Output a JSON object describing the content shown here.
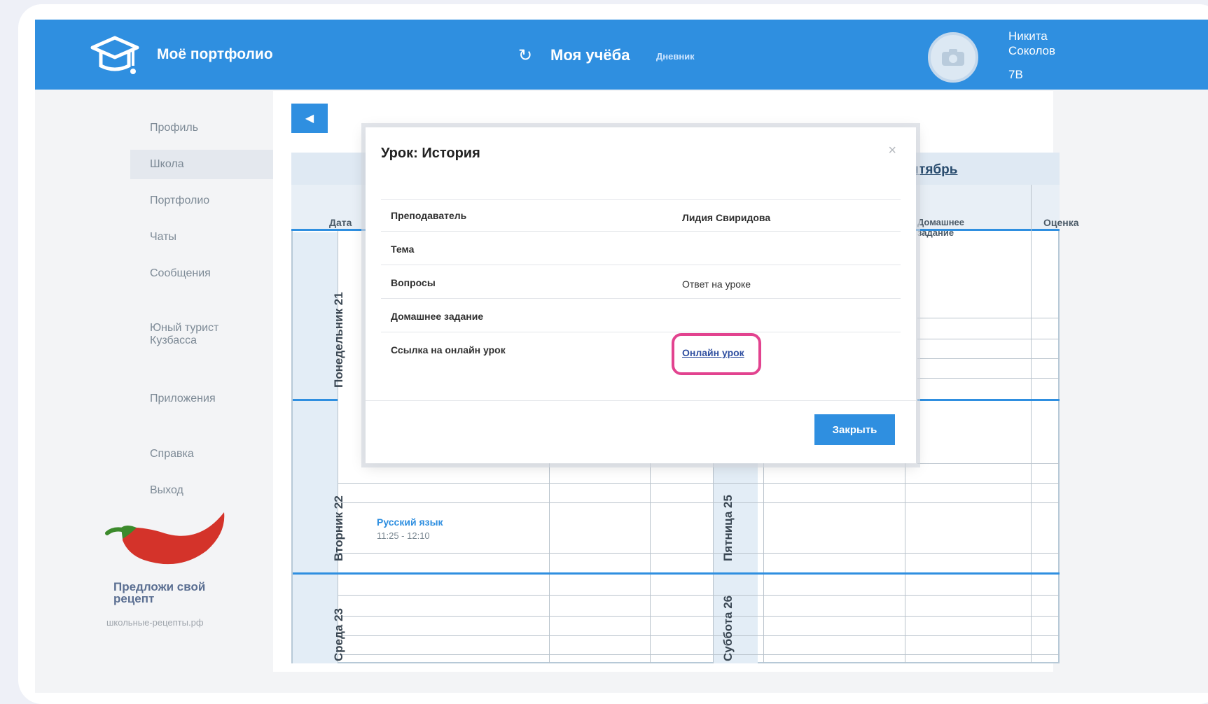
{
  "header": {
    "logo_text": "Моё портфолио",
    "study_title": "Моя учёба",
    "diary_link": "Дневник",
    "user_first": "Никита",
    "user_last": "Соколов",
    "user_class": "7В"
  },
  "sidebar": {
    "items": [
      {
        "label": "Профиль"
      },
      {
        "label": "Школа"
      },
      {
        "label": "Портфолио"
      },
      {
        "label": "Чаты"
      },
      {
        "label": "Сообщения"
      },
      {
        "label": "Юный турист Кузбасса"
      },
      {
        "label": "Приложения"
      },
      {
        "label": "Справка"
      },
      {
        "label": "Выход"
      }
    ],
    "chili_text": "Предложи свой рецепт",
    "promo_title": "Предложи свой рецепт",
    "promo_link": "школьные-рецепты.рф"
  },
  "diary": {
    "month": "ентябрь",
    "col_date": "Дата",
    "col_homework": "Домашнее задание",
    "col_grade": "Оценка",
    "days": [
      "Понедельник 21",
      "Вторник 22",
      "Среда 23",
      "Пятница 25",
      "Суббота 26"
    ],
    "lesson": {
      "name": "Русский язык",
      "time": "11:25 - 12:10"
    }
  },
  "modal": {
    "title": "Урок: История",
    "close_icon": "×",
    "rows": [
      {
        "label": "Преподаватель",
        "value": "Лидия Свиридова"
      },
      {
        "label": "Тема",
        "value": ""
      },
      {
        "label": "Вопросы",
        "value": "Ответ на уроке"
      },
      {
        "label": "Домашнее задание",
        "value": ""
      },
      {
        "label": "Ссылка на онлайн урок",
        "value": "Онлайн урок"
      }
    ],
    "close_button": "Закрыть"
  },
  "colors": {
    "accent": "#2f8fe0",
    "highlight": "#e2438f"
  }
}
